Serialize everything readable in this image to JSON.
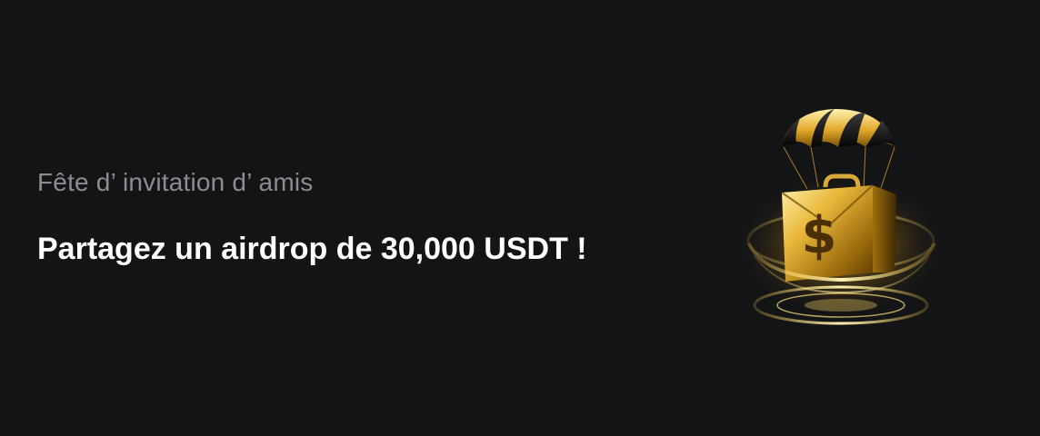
{
  "banner": {
    "subtitle": "Fête d’ invitation d’ amis",
    "headline": "Partagez un airdrop de 30,000 USDT !",
    "illustration": {
      "icon": "parachute-briefcase-dollar-icon",
      "symbol": "$"
    },
    "colors": {
      "background": "#131416",
      "subtitle": "#8b8d92",
      "headline": "#ffffff",
      "gold": "#e8b73a"
    }
  }
}
